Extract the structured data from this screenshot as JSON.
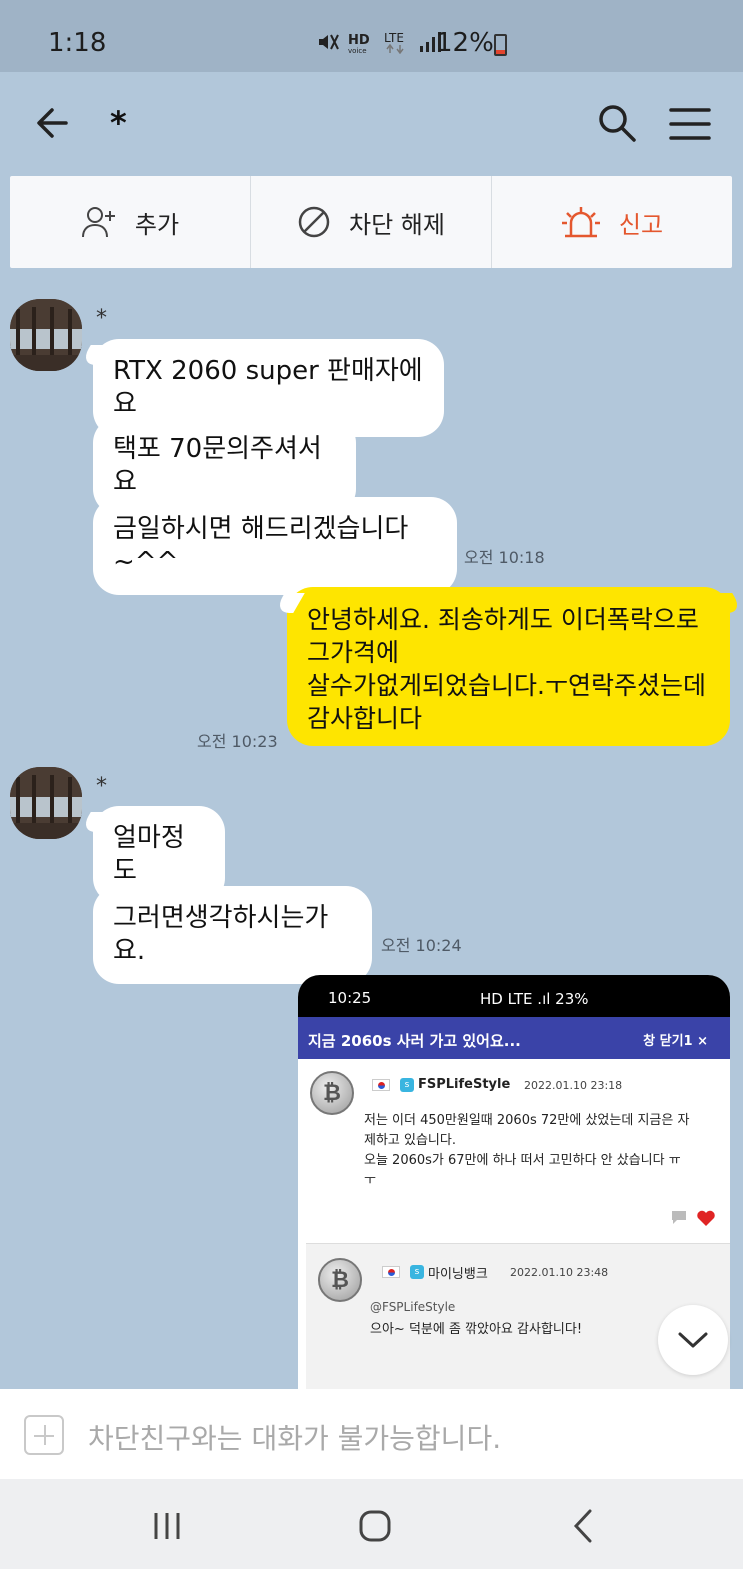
{
  "status_bar": {
    "time": "1:18",
    "battery": "12%",
    "icons": [
      "mute-icon",
      "hd-voice-icon",
      "lte-icon",
      "signal-icon",
      "battery-icon"
    ]
  },
  "header": {
    "title": "*"
  },
  "actions": {
    "add": "추가",
    "unblock": "차단 해제",
    "report": "신고"
  },
  "messages": {
    "sender1": "*",
    "m1": "RTX 2060 super 판매자에요",
    "m2": "택포 70문의주셔서요",
    "m3": "금일하시면 해드리겠습니다~^^",
    "t1": "오전 10:18",
    "mine1": "안녕하세요. 죄송하게도 이더폭락으로\n그가격에\n살수가없게되었습니다.ㅜ연락주셨는데\n감사합니다",
    "t2": "오전 10:23",
    "sender2": "*",
    "m4": "얼마정도",
    "m5": "그러면생각하시는가요.",
    "t3": "오전 10:24"
  },
  "screenshot": {
    "time": "10:25",
    "sys": "HD LTE .ıl 23%",
    "bar_title": "지금 2060s 사러 가고 있어요...",
    "bar_close": "창 닫기1 ×",
    "post_nick": "FSPLifeStyle",
    "post_date": "2022.01.10 23:18",
    "post_text": "저는 이더 450만원일때 2060s 72만에 샀었는데 지금은 자\n제하고 있습니다.\n오늘 2060s가 67만에 하나 떠서 고민하다 안 샀습니다 ㅠ\nㅜ",
    "reply_nick": "마이닝뱅크",
    "reply_date": "2022.01.10 23:48",
    "reply_mention": "@FSPLifeStyle",
    "reply_text": "으아~ 덕분에 좀 깎았아요 감사합니다!"
  },
  "input": {
    "placeholder": "차단친구와는 대화가 불가능합니다."
  },
  "colors": {
    "background": "#b2c7da",
    "my_bubble": "#fee500",
    "report": "#e4572e"
  }
}
